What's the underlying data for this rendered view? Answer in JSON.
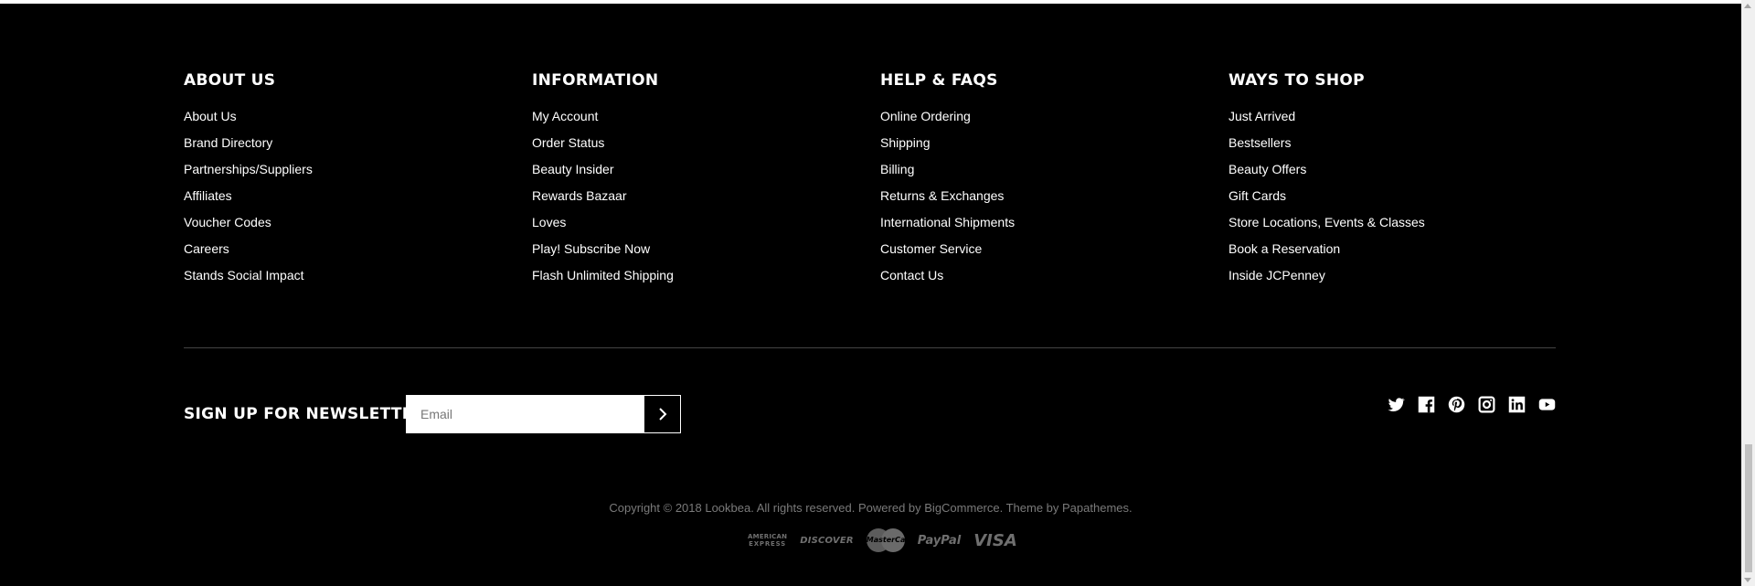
{
  "columns": [
    {
      "title": "About Us",
      "links": [
        "About Us",
        "Brand Directory",
        "Partnerships/Suppliers",
        "Affiliates",
        "Voucher Codes",
        "Careers",
        "Stands Social Impact"
      ]
    },
    {
      "title": "Information",
      "links": [
        "My Account",
        "Order Status",
        "Beauty Insider",
        "Rewards Bazaar",
        "Loves",
        "Play! Subscribe Now",
        "Flash Unlimited Shipping"
      ]
    },
    {
      "title": "Help & FAQs",
      "links": [
        "Online Ordering",
        "Shipping",
        "Billing",
        "Returns & Exchanges",
        "International Shipments",
        "Customer Service",
        "Contact Us"
      ]
    },
    {
      "title": "Ways To Shop",
      "links": [
        "Just Arrived",
        "Bestsellers",
        "Beauty Offers",
        "Gift Cards",
        "Store Locations, Events & Classes",
        "Book a Reservation",
        "Inside JCPenney"
      ]
    }
  ],
  "newsletter": {
    "title": "Sign Up For Newsletter",
    "placeholder": "Email"
  },
  "social_icons": [
    "twitter-icon",
    "facebook-icon",
    "pinterest-icon",
    "instagram-icon",
    "linkedin-icon",
    "youtube-icon"
  ],
  "copyright": "Copyright © 2018 Lookbea. All rights reserved. Powered by BigCommerce. Theme by Papathemes.",
  "payments": {
    "amex_line1": "AMERICAN",
    "amex_line2": "EXPRESS",
    "discover": "DISCOVER",
    "mastercard": "MasterCard",
    "paypal": "PayPal",
    "visa": "VISA"
  },
  "colors": {
    "background": "#000000",
    "text": "#ffffff",
    "muted": "#7a7a7a",
    "divider": "#444444"
  }
}
